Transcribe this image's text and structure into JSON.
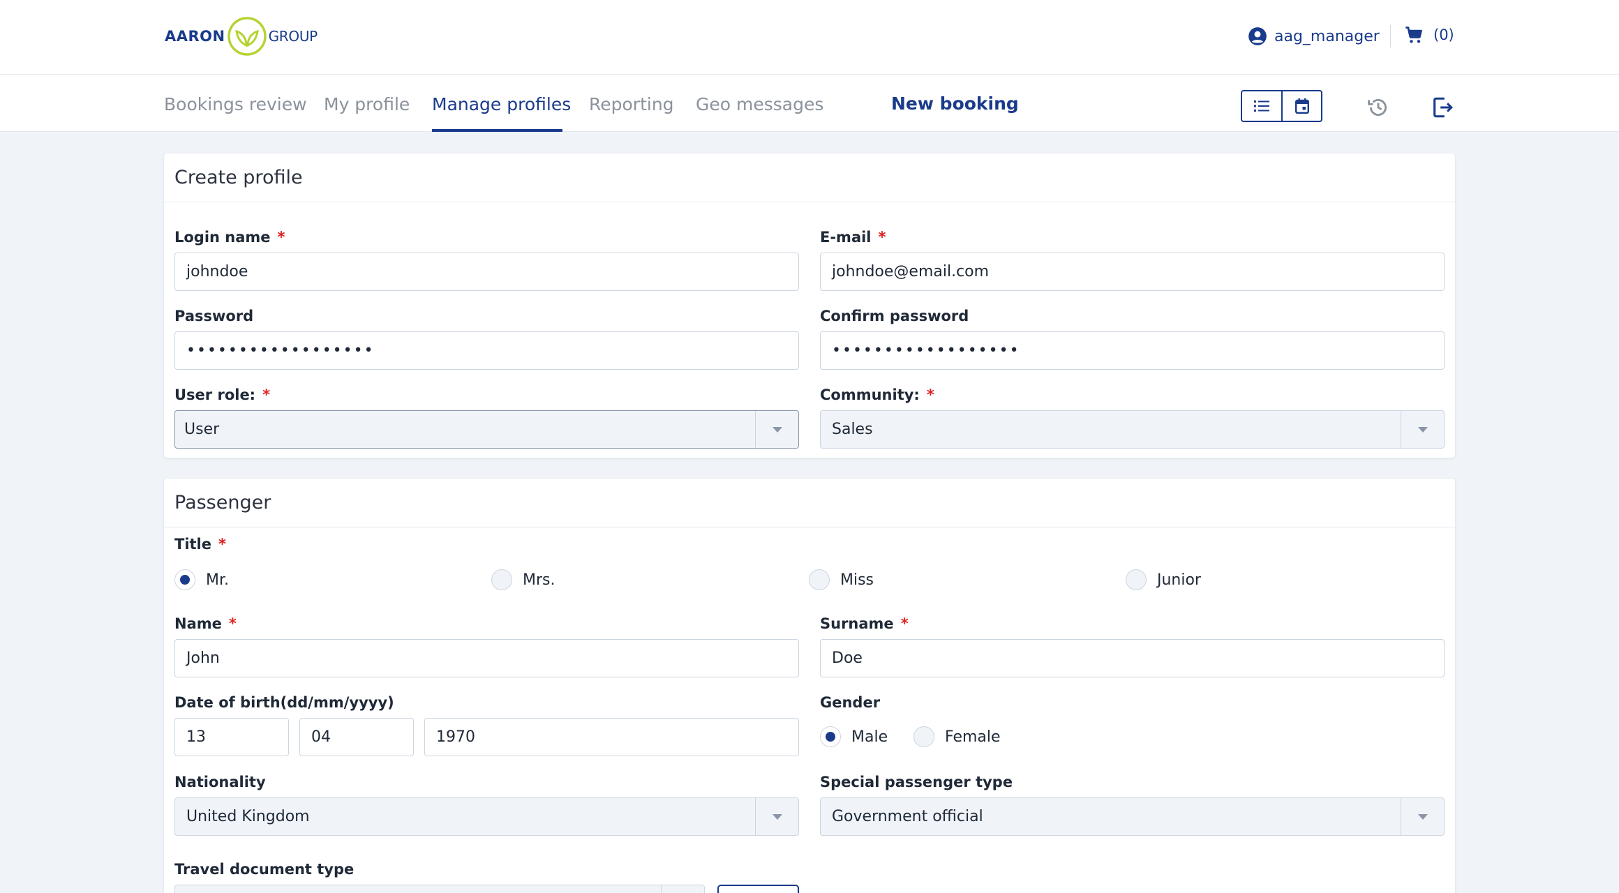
{
  "header": {
    "logo_left": "AARON",
    "logo_right": "GROUP",
    "username": "aag_manager",
    "cart_count": "(0)"
  },
  "nav": {
    "tabs": [
      {
        "label": "Bookings review",
        "active": false
      },
      {
        "label": "My profile",
        "active": false
      },
      {
        "label": "Manage profiles",
        "active": true
      },
      {
        "label": "Reporting",
        "active": false
      },
      {
        "label": "Geo messages",
        "active": false
      }
    ],
    "new_booking": "New booking",
    "icons": [
      "list-view-icon",
      "calendar-view-icon",
      "history-icon",
      "logout-icon"
    ]
  },
  "create_profile": {
    "title": "Create profile",
    "login_name_label": "Login name",
    "login_name_value": "johndoe",
    "email_label": "E-mail",
    "email_value": "johndoe@email.com",
    "password_label": "Password",
    "password_value": "••••••••••••••••••",
    "confirm_password_label": "Confirm password",
    "confirm_password_value": "••••••••••••••••••",
    "user_role_label": "User role:",
    "user_role_value": "User",
    "community_label": "Community:",
    "community_value": "Sales",
    "required_mark": "*"
  },
  "passenger": {
    "title": "Passenger",
    "title_label": "Title",
    "title_options": [
      "Mr.",
      "Mrs.",
      "Miss",
      "Junior"
    ],
    "title_selected": "Mr.",
    "name_label": "Name",
    "name_value": "John",
    "surname_label": "Surname",
    "surname_value": "Doe",
    "dob_label": "Date of birth(dd/mm/yyyy)",
    "dob_day": "13",
    "dob_month": "04",
    "dob_year": "1970",
    "gender_label": "Gender",
    "gender_options": [
      "Male",
      "Female"
    ],
    "gender_selected": "Male",
    "nationality_label": "Nationality",
    "nationality_value": "United Kingdom",
    "special_type_label": "Special passenger type",
    "special_type_value": "Government official",
    "travel_doc_label": "Travel document type"
  },
  "colors": {
    "brand": "#1a3b8c",
    "logo_green": "#b5d334",
    "required": "#e02020",
    "background": "#f0f4f9"
  }
}
